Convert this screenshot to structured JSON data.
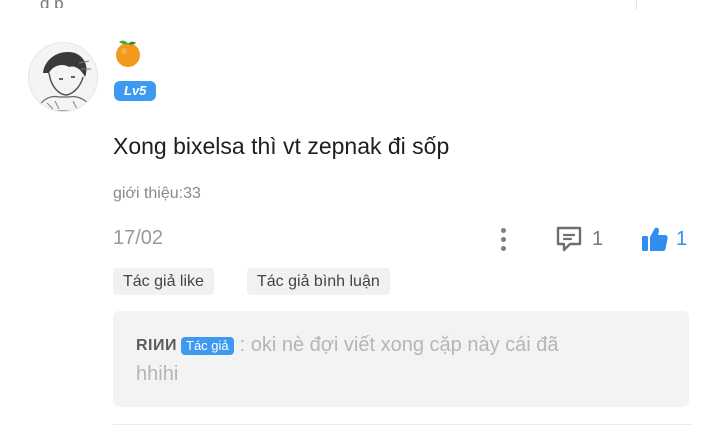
{
  "top_fragment": "g      p",
  "comment": {
    "emoji_icon": "tangerine-icon",
    "level": "Lv5",
    "text": "Xong bixelsa thì vt zepnak đi sốp",
    "intro": "giới thiệu:33",
    "date": "17/02",
    "reply_count": "1",
    "like_count": "1",
    "accent_color": "#3d9af0"
  },
  "tags": {
    "author_like": "Tác giả like",
    "author_reply": "Tác giả bình luận"
  },
  "reply": {
    "author": "RIИИ",
    "badge": "Tác giả",
    "text_line1": ": oki nè đợi viết xong cặp này cái đã",
    "text_line2": "hhihi"
  }
}
